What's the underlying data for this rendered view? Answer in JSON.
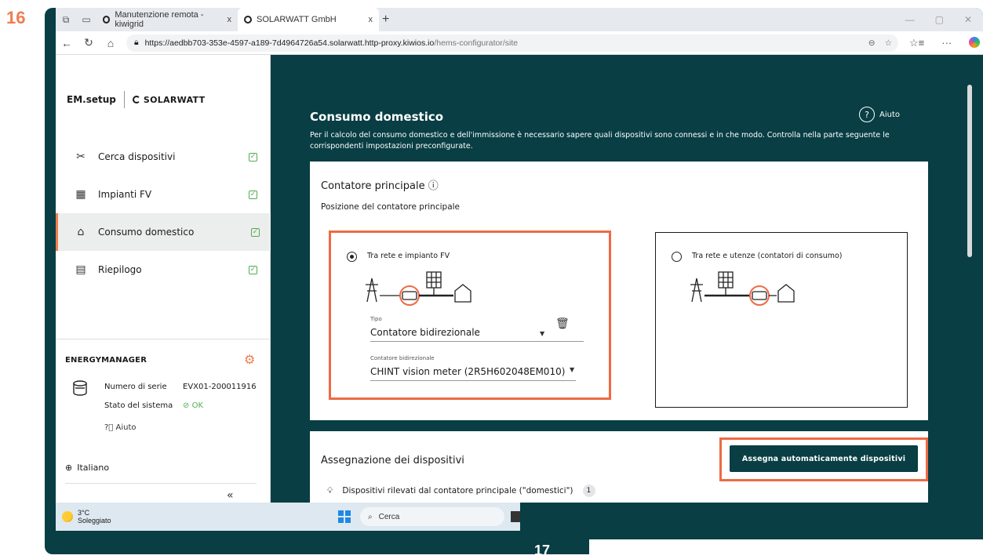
{
  "step_number": "16",
  "next_step_number": "17",
  "browser": {
    "tabs": [
      {
        "title": "Manutenzione remota - kiwigrid",
        "close": "x"
      },
      {
        "title": "SOLARWATT GmbH",
        "close": "x"
      }
    ],
    "new_tab": "+",
    "url_host": "https://aedbb703-353e-4597-a189-7d4964726a54.solarwatt.http-proxy.kiwios.io",
    "url_path": "/hems-configurator/site"
  },
  "sidebar": {
    "brand_app": "EM.setup",
    "brand_company": "SOLARWATT",
    "items": [
      {
        "label": "Cerca dispositivi",
        "icon": "tools-icon",
        "checked": true
      },
      {
        "label": "Impianti FV",
        "icon": "solar-panel-icon",
        "checked": true
      },
      {
        "label": "Consumo domestico",
        "icon": "house-icon",
        "checked": true,
        "active": true
      },
      {
        "label": "Riepilogo",
        "icon": "clipboard-icon",
        "checked": true
      }
    ],
    "energymanager": {
      "title": "ENERGYMANAGER",
      "serial_label": "Numero di serie",
      "serial_value": "EVX01-200011916",
      "status_label": "Stato del sistema",
      "status_value": "OK",
      "help": "Aiuto"
    },
    "language": "Italiano",
    "collapse": "«"
  },
  "main": {
    "title": "Consumo domestico",
    "help": "Aiuto",
    "description": "Per il calcolo del consumo domestico e dell'immissione è necessario sapere quali dispositivi sono connessi e in che modo. Controlla nella parte seguente le corrispondenti impostazioni preconfigurate.",
    "meter_card": {
      "title": "Contatore principale ⓘ",
      "subtitle": "Posizione del contatore principale",
      "option_a": {
        "label": "Tra rete e impianto FV",
        "selected": true,
        "type_label": "Tipo",
        "type_value": "Contatore bidirezionale",
        "meter_label": "Contatore bidirezionale",
        "meter_value": "CHINT vision meter (2R5H602048EM010)"
      },
      "option_b": {
        "label": "Tra rete e utenze (contatori di consumo)",
        "selected": false
      }
    },
    "devices_card": {
      "title": "Assegnazione dei dispositivi",
      "auto_button": "Assegna automaticamente dispositivi",
      "detected_label": "Dispositivi rilevati dal contatore principale (\"domestici\")",
      "detected_count": "1"
    }
  },
  "taskbar": {
    "temperature": "3°C",
    "weather": "Soleggiato",
    "search": "Cerca"
  },
  "colors": {
    "teal": "#083e44",
    "highlight": "#ef6a43",
    "check": "#4caf50"
  }
}
